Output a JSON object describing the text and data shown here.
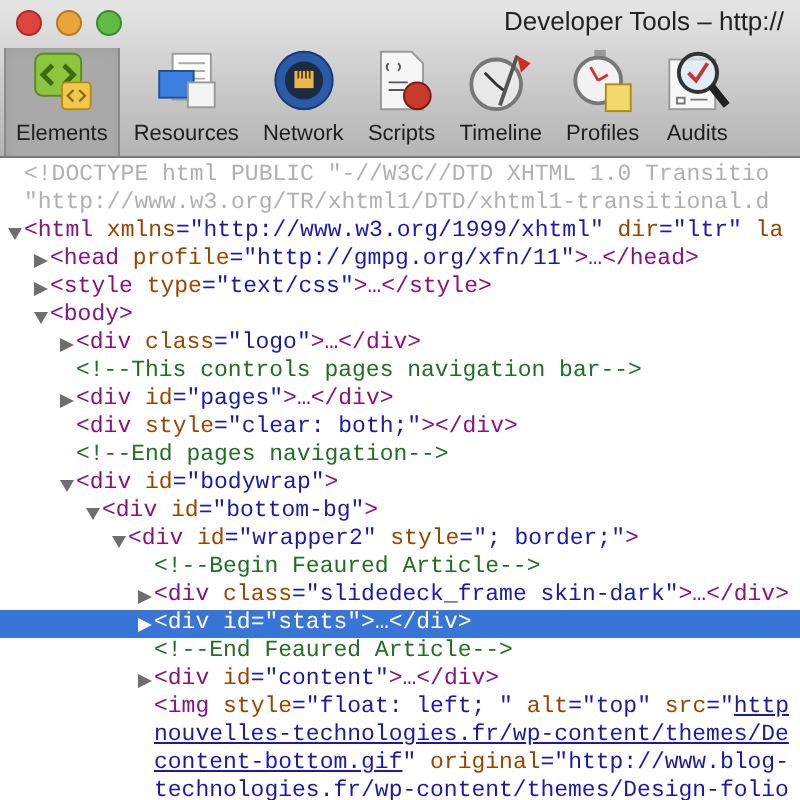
{
  "window": {
    "title": "Developer Tools – http://"
  },
  "toolbar": [
    {
      "label": "Elements",
      "kind": "elements",
      "selected": true
    },
    {
      "label": "Resources",
      "kind": "resources",
      "selected": false
    },
    {
      "label": "Network",
      "kind": "network",
      "selected": false
    },
    {
      "label": "Scripts",
      "kind": "scripts",
      "selected": false
    },
    {
      "label": "Timeline",
      "kind": "timeline",
      "selected": false
    },
    {
      "label": "Profiles",
      "kind": "profiles",
      "selected": false
    },
    {
      "label": "Audits",
      "kind": "audits",
      "selected": false
    }
  ],
  "tree": [
    {
      "selected": false,
      "segments": [
        {
          "kind": "doctype",
          "text": "<!DOCTYPE html PUBLIC \"-//W3C//DTD XHTML 1.0 Transitio"
        }
      ],
      "wrapped": [
        [
          {
            "kind": "doctype",
            "text": "\"http://www.w3.org/TR/xhtml1/DTD/xhtml1-transitional.d"
          }
        ]
      ]
    },
    {
      "selected": false,
      "expanded": true,
      "segments": [
        {
          "kind": "tag",
          "text": "<html"
        },
        {
          "kind": "attr",
          "text": " xmlns"
        },
        {
          "kind": "value",
          "text": "=\"http://www.w3.org/1999/xhtml\""
        },
        {
          "kind": "attr",
          "text": " dir"
        },
        {
          "kind": "value",
          "text": "=\"ltr\""
        },
        {
          "kind": "attr",
          "text": " la"
        }
      ],
      "children": [
        {
          "selected": false,
          "expanded": false,
          "segments": [
            {
              "kind": "tag",
              "text": "<head"
            },
            {
              "kind": "attr",
              "text": " profile"
            },
            {
              "kind": "value",
              "text": "=\"http://gmpg.org/xfn/11\""
            },
            {
              "kind": "tag",
              "text": ">…</head>"
            }
          ]
        },
        {
          "selected": false,
          "expanded": false,
          "segments": [
            {
              "kind": "tag",
              "text": "<style"
            },
            {
              "kind": "attr",
              "text": " type"
            },
            {
              "kind": "value",
              "text": "=\"text/css\""
            },
            {
              "kind": "tag",
              "text": ">…</style>"
            }
          ]
        },
        {
          "selected": false,
          "expanded": true,
          "segments": [
            {
              "kind": "tag",
              "text": "<body>"
            }
          ],
          "children": [
            {
              "selected": false,
              "expanded": false,
              "segments": [
                {
                  "kind": "tag",
                  "text": "<div"
                },
                {
                  "kind": "attr",
                  "text": " class"
                },
                {
                  "kind": "value",
                  "text": "=\"logo\""
                },
                {
                  "kind": "tag",
                  "text": ">…</div>"
                }
              ]
            },
            {
              "selected": false,
              "segments": [
                {
                  "kind": "comment",
                  "text": "<!--This controls pages navigation bar-->"
                }
              ]
            },
            {
              "selected": false,
              "expanded": false,
              "segments": [
                {
                  "kind": "tag",
                  "text": "<div"
                },
                {
                  "kind": "attr",
                  "text": " id"
                },
                {
                  "kind": "value",
                  "text": "=\"pages\""
                },
                {
                  "kind": "tag",
                  "text": ">…</div>"
                }
              ]
            },
            {
              "selected": false,
              "segments": [
                {
                  "kind": "tag",
                  "text": "<div"
                },
                {
                  "kind": "attr",
                  "text": " style"
                },
                {
                  "kind": "value",
                  "text": "=\"clear: both;\""
                },
                {
                  "kind": "tag",
                  "text": "></div>"
                }
              ]
            },
            {
              "selected": false,
              "segments": [
                {
                  "kind": "comment",
                  "text": "<!--End pages navigation-->"
                }
              ]
            },
            {
              "selected": false,
              "expanded": true,
              "segments": [
                {
                  "kind": "tag",
                  "text": "<div"
                },
                {
                  "kind": "attr",
                  "text": " id"
                },
                {
                  "kind": "value",
                  "text": "=\"bodywrap\""
                },
                {
                  "kind": "tag",
                  "text": ">"
                }
              ],
              "children": [
                {
                  "selected": false,
                  "expanded": true,
                  "segments": [
                    {
                      "kind": "tag",
                      "text": "<div"
                    },
                    {
                      "kind": "attr",
                      "text": " id"
                    },
                    {
                      "kind": "value",
                      "text": "=\"bottom-bg\""
                    },
                    {
                      "kind": "tag",
                      "text": ">"
                    }
                  ],
                  "children": [
                    {
                      "selected": false,
                      "expanded": true,
                      "segments": [
                        {
                          "kind": "tag",
                          "text": "<div"
                        },
                        {
                          "kind": "attr",
                          "text": " id"
                        },
                        {
                          "kind": "value",
                          "text": "=\"wrapper2\""
                        },
                        {
                          "kind": "attr",
                          "text": " style"
                        },
                        {
                          "kind": "value",
                          "text": "=\"; border;\""
                        },
                        {
                          "kind": "tag",
                          "text": ">"
                        }
                      ],
                      "children": [
                        {
                          "selected": false,
                          "segments": [
                            {
                              "kind": "comment",
                              "text": "<!--Begin Feaured Article-->"
                            }
                          ]
                        },
                        {
                          "selected": false,
                          "expanded": false,
                          "segments": [
                            {
                              "kind": "tag",
                              "text": "<div"
                            },
                            {
                              "kind": "attr",
                              "text": " class"
                            },
                            {
                              "kind": "value",
                              "text": "=\"slidedeck_frame skin-dark\""
                            },
                            {
                              "kind": "tag",
                              "text": ">…</div>"
                            }
                          ]
                        },
                        {
                          "selected": true,
                          "expanded": false,
                          "segments": [
                            {
                              "kind": "tag",
                              "text": "<div"
                            },
                            {
                              "kind": "attr",
                              "text": " id"
                            },
                            {
                              "kind": "value",
                              "text": "=\"stats\""
                            },
                            {
                              "kind": "tag",
                              "text": ">…</div>"
                            }
                          ]
                        },
                        {
                          "selected": false,
                          "segments": [
                            {
                              "kind": "comment",
                              "text": "<!--End Feaured Article-->"
                            }
                          ]
                        },
                        {
                          "selected": false,
                          "expanded": false,
                          "segments": [
                            {
                              "kind": "tag",
                              "text": "<div"
                            },
                            {
                              "kind": "attr",
                              "text": " id"
                            },
                            {
                              "kind": "value",
                              "text": "=\"content\""
                            },
                            {
                              "kind": "tag",
                              "text": ">…</div>"
                            }
                          ]
                        },
                        {
                          "selected": false,
                          "segments": [
                            {
                              "kind": "tag",
                              "text": "<img"
                            },
                            {
                              "kind": "attr",
                              "text": " style"
                            },
                            {
                              "kind": "value",
                              "text": "=\"float: left; \""
                            },
                            {
                              "kind": "attr",
                              "text": " alt"
                            },
                            {
                              "kind": "value",
                              "text": "=\"top\""
                            },
                            {
                              "kind": "attr",
                              "text": " src"
                            },
                            {
                              "kind": "value",
                              "text": "=\""
                            },
                            {
                              "kind": "link",
                              "text": "http"
                            }
                          ],
                          "wrapped": [
                            [
                              {
                                "kind": "link",
                                "text": "nouvelles-technologies.fr/wp-content/themes/De"
                              }
                            ],
                            [
                              {
                                "kind": "link",
                                "text": "content-bottom.gif"
                              },
                              {
                                "kind": "value",
                                "text": "\""
                              },
                              {
                                "kind": "attr",
                                "text": " original"
                              },
                              {
                                "kind": "value",
                                "text": "=\"http://www.blog-"
                              }
                            ],
                            [
                              {
                                "kind": "value",
                                "text": "technologies.fr/wp-content/themes/Design-folio"
                              }
                            ]
                          ]
                        }
                      ]
                    }
                  ]
                }
              ]
            }
          ]
        }
      ]
    }
  ]
}
